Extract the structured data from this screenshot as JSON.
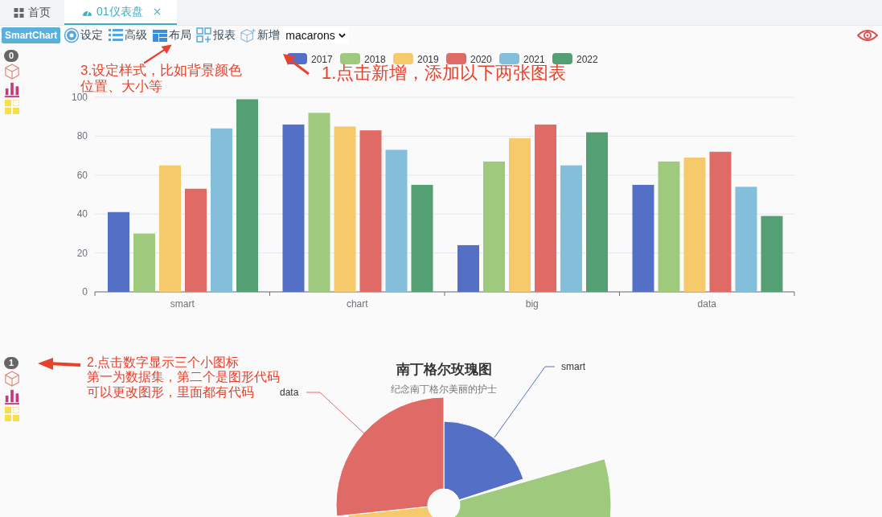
{
  "tabs": [
    {
      "label": "首页",
      "selected": false,
      "closable": false
    },
    {
      "label": "01仪表盘",
      "selected": true,
      "closable": true
    }
  ],
  "toolbar": {
    "brand": "SmartChart",
    "items": [
      {
        "label": "设定",
        "kind": "gear"
      },
      {
        "label": "高级",
        "kind": "list"
      },
      {
        "label": "布局",
        "kind": "layout"
      },
      {
        "label": "报表",
        "kind": "report"
      },
      {
        "label": "新增",
        "kind": "cube"
      }
    ],
    "theme_select": {
      "value": "macarons"
    }
  },
  "charts": [
    {
      "badge": "0",
      "chart_data": {
        "type": "bar",
        "grid": true,
        "legend": true,
        "categories": [
          "smart",
          "chart",
          "big",
          "data"
        ],
        "ylim": [
          0,
          100
        ],
        "yticks": [
          0,
          20,
          40,
          60,
          80,
          100
        ],
        "series": [
          {
            "name": "2017",
            "color": "#5470c6",
            "values": [
              41,
              86,
              24,
              55
            ]
          },
          {
            "name": "2018",
            "color": "#9fca7d",
            "values": [
              30,
              92,
              67,
              67
            ]
          },
          {
            "name": "2019",
            "color": "#f6c96b",
            "values": [
              65,
              85,
              79,
              69
            ]
          },
          {
            "name": "2020",
            "color": "#e06b66",
            "values": [
              53,
              83,
              86,
              72
            ]
          },
          {
            "name": "2021",
            "color": "#83bedb",
            "values": [
              84,
              73,
              65,
              54
            ]
          },
          {
            "name": "2022",
            "color": "#549f73",
            "values": [
              99,
              55,
              82,
              39
            ]
          }
        ]
      }
    },
    {
      "badge": "1",
      "title": "南丁格尔玫瑰图",
      "subtitle": "纪念南丁格尔美丽的护士",
      "labels": [
        "smart",
        "data"
      ]
    }
  ],
  "annotations": [
    {
      "lines": [
        "3.设定样式，比如背景颜色",
        "位置、大小等"
      ]
    },
    {
      "lines": [
        "1.点击新增，添加以下两张图表"
      ]
    },
    {
      "lines": [
        "2.点击数字显示三个小图标",
        "第一为数据集，第二个是图形代码",
        "可以更改图形，里面都有代码"
      ]
    }
  ]
}
